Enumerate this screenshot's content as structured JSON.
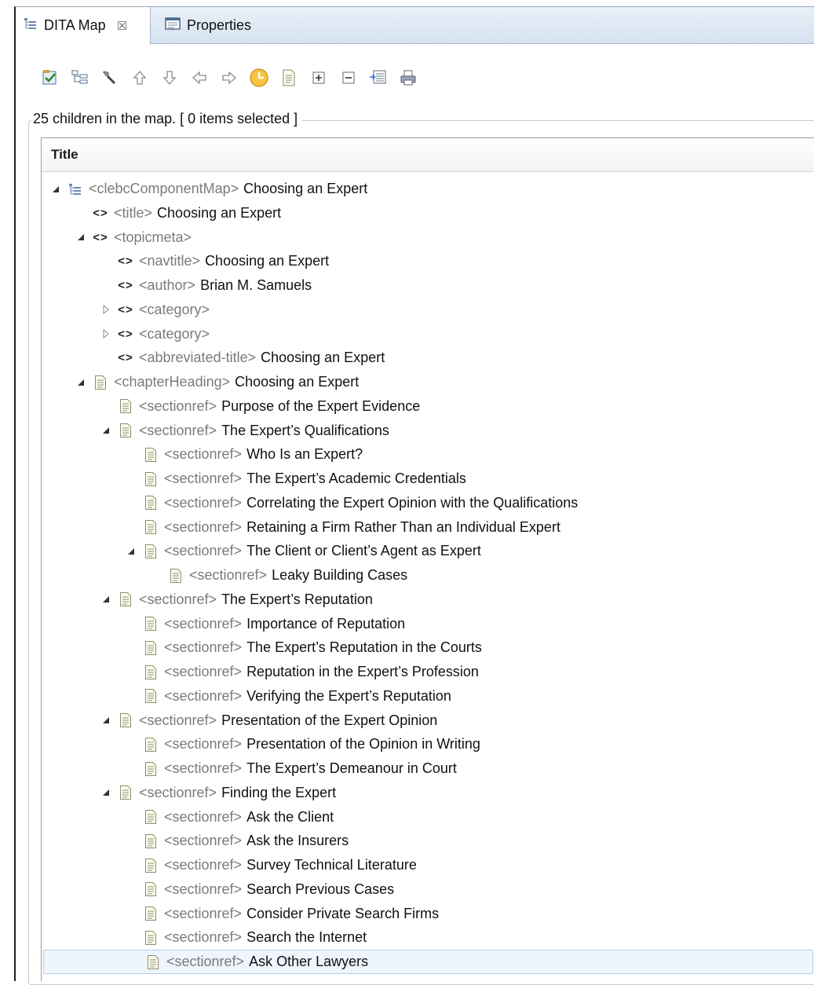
{
  "tabs": [
    {
      "label": "DITA Map",
      "close": "☒"
    },
    {
      "label": "Properties"
    }
  ],
  "toolbar": [
    "validate-icon",
    "map-structure-icon",
    "search-icon",
    "move-up-icon",
    "move-down-icon",
    "promote-icon",
    "demote-icon",
    "clock-icon",
    "document-icon",
    "expand-all-icon",
    "collapse-all-icon",
    "insert-icon",
    "print-icon"
  ],
  "status": "25 children in the map. [ 0 items selected ]",
  "column_header": "Title",
  "tree": [
    {
      "level": 0,
      "toggle": "expanded",
      "icon": "map-icon",
      "tag": "<clebcComponentMap>",
      "title": "Choosing an Expert"
    },
    {
      "level": 1,
      "toggle": "none",
      "icon": "element-icon",
      "tag": "<title>",
      "title": "Choosing an Expert"
    },
    {
      "level": 1,
      "toggle": "expanded",
      "icon": "element-icon",
      "tag": "<topicmeta>",
      "title": ""
    },
    {
      "level": 2,
      "toggle": "none",
      "icon": "element-icon",
      "tag": "<navtitle>",
      "title": "Choosing an Expert"
    },
    {
      "level": 2,
      "toggle": "none",
      "icon": "element-icon",
      "tag": "<author>",
      "title": "Brian M. Samuels"
    },
    {
      "level": 2,
      "toggle": "collapsed",
      "icon": "element-icon",
      "tag": "<category>",
      "title": ""
    },
    {
      "level": 2,
      "toggle": "collapsed",
      "icon": "element-icon",
      "tag": "<category>",
      "title": ""
    },
    {
      "level": 2,
      "toggle": "none",
      "icon": "element-icon",
      "tag": "<abbreviated-title>",
      "title": "Choosing an Expert"
    },
    {
      "level": 1,
      "toggle": "expanded",
      "icon": "document-icon",
      "tag": "<chapterHeading>",
      "title": "Choosing an Expert"
    },
    {
      "level": 2,
      "toggle": "none",
      "icon": "document-icon",
      "tag": "<sectionref>",
      "title": "Purpose of the Expert Evidence"
    },
    {
      "level": 2,
      "toggle": "expanded",
      "icon": "document-icon",
      "tag": "<sectionref>",
      "title": "The Expert’s Qualifications"
    },
    {
      "level": 3,
      "toggle": "none",
      "icon": "document-icon",
      "tag": "<sectionref>",
      "title": "Who Is an Expert?"
    },
    {
      "level": 3,
      "toggle": "none",
      "icon": "document-icon",
      "tag": "<sectionref>",
      "title": "The Expert’s Academic Credentials"
    },
    {
      "level": 3,
      "toggle": "none",
      "icon": "document-icon",
      "tag": "<sectionref>",
      "title": "Correlating the Expert Opinion with the Qualifications"
    },
    {
      "level": 3,
      "toggle": "none",
      "icon": "document-icon",
      "tag": "<sectionref>",
      "title": "Retaining a Firm Rather Than an Individual Expert"
    },
    {
      "level": 3,
      "toggle": "expanded",
      "icon": "document-icon",
      "tag": "<sectionref>",
      "title": "The Client or Client’s Agent as Expert"
    },
    {
      "level": 4,
      "toggle": "none",
      "icon": "document-icon",
      "tag": "<sectionref>",
      "title": "Leaky Building Cases"
    },
    {
      "level": 2,
      "toggle": "expanded",
      "icon": "document-icon",
      "tag": "<sectionref>",
      "title": "The Expert’s Reputation"
    },
    {
      "level": 3,
      "toggle": "none",
      "icon": "document-icon",
      "tag": "<sectionref>",
      "title": "Importance of Reputation"
    },
    {
      "level": 3,
      "toggle": "none",
      "icon": "document-icon",
      "tag": "<sectionref>",
      "title": "The Expert’s Reputation in the Courts"
    },
    {
      "level": 3,
      "toggle": "none",
      "icon": "document-icon",
      "tag": "<sectionref>",
      "title": "Reputation in the Expert’s Profession"
    },
    {
      "level": 3,
      "toggle": "none",
      "icon": "document-icon",
      "tag": "<sectionref>",
      "title": "Verifying the Expert’s Reputation"
    },
    {
      "level": 2,
      "toggle": "expanded",
      "icon": "document-icon",
      "tag": "<sectionref>",
      "title": "Presentation of the Expert Opinion"
    },
    {
      "level": 3,
      "toggle": "none",
      "icon": "document-icon",
      "tag": "<sectionref>",
      "title": "Presentation of the Opinion in Writing"
    },
    {
      "level": 3,
      "toggle": "none",
      "icon": "document-icon",
      "tag": "<sectionref>",
      "title": "The Expert’s Demeanour in Court"
    },
    {
      "level": 2,
      "toggle": "expanded",
      "icon": "document-icon",
      "tag": "<sectionref>",
      "title": "Finding the Expert"
    },
    {
      "level": 3,
      "toggle": "none",
      "icon": "document-icon",
      "tag": "<sectionref>",
      "title": "Ask the Client"
    },
    {
      "level": 3,
      "toggle": "none",
      "icon": "document-icon",
      "tag": "<sectionref>",
      "title": "Ask the Insurers"
    },
    {
      "level": 3,
      "toggle": "none",
      "icon": "document-icon",
      "tag": "<sectionref>",
      "title": "Survey Technical Literature"
    },
    {
      "level": 3,
      "toggle": "none",
      "icon": "document-icon",
      "tag": "<sectionref>",
      "title": "Search Previous Cases"
    },
    {
      "level": 3,
      "toggle": "none",
      "icon": "document-icon",
      "tag": "<sectionref>",
      "title": "Consider Private Search Firms"
    },
    {
      "level": 3,
      "toggle": "none",
      "icon": "document-icon",
      "tag": "<sectionref>",
      "title": "Search the Internet"
    },
    {
      "level": 3,
      "toggle": "none",
      "icon": "document-icon",
      "tag": "<sectionref>",
      "title": "Ask Other Lawyers",
      "selected": true
    }
  ]
}
